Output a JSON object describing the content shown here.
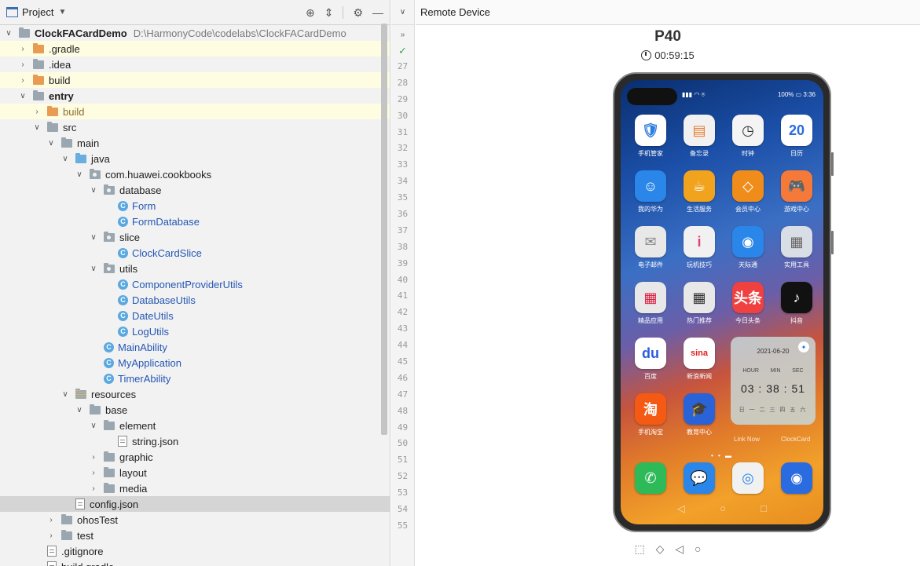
{
  "project_panel": {
    "title": "Project",
    "tree": [
      {
        "label": "ClockFACardDemo",
        "path": "D:\\HarmonyCode\\codelabs\\ClockFACardDemo",
        "depth": 0,
        "arrow": "open",
        "icon": "module",
        "style": "bold"
      },
      {
        "label": ".gradle",
        "depth": 1,
        "arrow": "closed",
        "icon": "orange",
        "hl": true
      },
      {
        "label": ".idea",
        "depth": 1,
        "arrow": "closed",
        "icon": "folder"
      },
      {
        "label": "build",
        "depth": 1,
        "arrow": "closed",
        "icon": "orange",
        "hl": true
      },
      {
        "label": "entry",
        "depth": 1,
        "arrow": "open",
        "icon": "module",
        "style": "bold"
      },
      {
        "label": "build",
        "depth": 2,
        "arrow": "closed",
        "icon": "orange",
        "hl": true,
        "style": "dimorange"
      },
      {
        "label": "src",
        "depth": 2,
        "arrow": "open",
        "icon": "folder"
      },
      {
        "label": "main",
        "depth": 3,
        "arrow": "open",
        "icon": "folder"
      },
      {
        "label": "java",
        "depth": 4,
        "arrow": "open",
        "icon": "blue"
      },
      {
        "label": "com.huawei.cookbooks",
        "depth": 5,
        "arrow": "open",
        "icon": "pkg"
      },
      {
        "label": "database",
        "depth": 6,
        "arrow": "open",
        "icon": "pkg"
      },
      {
        "label": "Form",
        "depth": 7,
        "arrow": "none",
        "icon": "class",
        "style": "blue"
      },
      {
        "label": "FormDatabase",
        "depth": 7,
        "arrow": "none",
        "icon": "class",
        "style": "blue"
      },
      {
        "label": "slice",
        "depth": 6,
        "arrow": "open",
        "icon": "pkg"
      },
      {
        "label": "ClockCardSlice",
        "depth": 7,
        "arrow": "none",
        "icon": "class",
        "style": "blue"
      },
      {
        "label": "utils",
        "depth": 6,
        "arrow": "open",
        "icon": "pkg"
      },
      {
        "label": "ComponentProviderUtils",
        "depth": 7,
        "arrow": "none",
        "icon": "class",
        "style": "blue"
      },
      {
        "label": "DatabaseUtils",
        "depth": 7,
        "arrow": "none",
        "icon": "class",
        "style": "blue"
      },
      {
        "label": "DateUtils",
        "depth": 7,
        "arrow": "none",
        "icon": "class",
        "style": "blue"
      },
      {
        "label": "LogUtils",
        "depth": 7,
        "arrow": "none",
        "icon": "class",
        "style": "blue"
      },
      {
        "label": "MainAbility",
        "depth": 6,
        "arrow": "none",
        "icon": "class",
        "style": "blue"
      },
      {
        "label": "MyApplication",
        "depth": 6,
        "arrow": "none",
        "icon": "class",
        "style": "blue"
      },
      {
        "label": "TimerAbility",
        "depth": 6,
        "arrow": "none",
        "icon": "class",
        "style": "blue"
      },
      {
        "label": "resources",
        "depth": 4,
        "arrow": "open",
        "icon": "res"
      },
      {
        "label": "base",
        "depth": 5,
        "arrow": "open",
        "icon": "folder"
      },
      {
        "label": "element",
        "depth": 6,
        "arrow": "open",
        "icon": "folder"
      },
      {
        "label": "string.json",
        "depth": 7,
        "arrow": "none",
        "icon": "file"
      },
      {
        "label": "graphic",
        "depth": 6,
        "arrow": "closed",
        "icon": "folder"
      },
      {
        "label": "layout",
        "depth": 6,
        "arrow": "closed",
        "icon": "folder"
      },
      {
        "label": "media",
        "depth": 6,
        "arrow": "closed",
        "icon": "folder"
      },
      {
        "label": "config.json",
        "depth": 4,
        "arrow": "none",
        "icon": "file",
        "sel": true
      },
      {
        "label": "ohosTest",
        "depth": 3,
        "arrow": "closed",
        "icon": "folder"
      },
      {
        "label": "test",
        "depth": 3,
        "arrow": "closed",
        "icon": "folder"
      },
      {
        "label": ".gitignore",
        "depth": 2,
        "arrow": "none",
        "icon": "file"
      },
      {
        "label": "build.gradle",
        "depth": 2,
        "arrow": "none",
        "icon": "file"
      }
    ]
  },
  "gutter": {
    "lines": [
      "27",
      "28",
      "29",
      "30",
      "31",
      "32",
      "33",
      "34",
      "35",
      "36",
      "37",
      "38",
      "39",
      "40",
      "41",
      "42",
      "43",
      "44",
      "45",
      "46",
      "47",
      "48",
      "49",
      "50",
      "51",
      "52",
      "53",
      "54",
      "55"
    ]
  },
  "remote_device": {
    "header": "Remote Device",
    "device": "P40",
    "timer": "00:59:15",
    "status_right": "100% ▭ 3:36",
    "apps": [
      {
        "name": "手机管家",
        "color": "#ffffff",
        "glyph": "🛡",
        "fg": "#2a7de1"
      },
      {
        "name": "备忘录",
        "color": "#f1f1f1",
        "glyph": "▤",
        "fg": "#e97a2a"
      },
      {
        "name": "时钟",
        "color": "#f4f4f4",
        "glyph": "◷",
        "fg": "#333"
      },
      {
        "name": "日历",
        "color": "#ffffff",
        "glyph": "20",
        "fg": "#2a6be0"
      },
      {
        "name": "我的华为",
        "color": "#2a86e8",
        "glyph": "☺",
        "fg": "#fff"
      },
      {
        "name": "生活服务",
        "color": "#f2a31e",
        "glyph": "☕",
        "fg": "#fff"
      },
      {
        "name": "会员中心",
        "color": "#f08d1a",
        "glyph": "◇",
        "fg": "#fff"
      },
      {
        "name": "游戏中心",
        "color": "#f57a3a",
        "glyph": "🎮",
        "fg": "#fff"
      },
      {
        "name": "电子邮件",
        "color": "#e8e8e8",
        "glyph": "✉",
        "fg": "#888"
      },
      {
        "name": "玩机技巧",
        "color": "#f1f1f1",
        "glyph": "i",
        "fg": "#e0407a"
      },
      {
        "name": "天际通",
        "color": "#2a86e8",
        "glyph": "◉",
        "fg": "#fff"
      },
      {
        "name": "实用工具",
        "color": "#d9dde5",
        "glyph": "▦",
        "fg": "#666"
      },
      {
        "name": "精品应用",
        "color": "#e8e8e8",
        "glyph": "▦",
        "fg": "#d24"
      },
      {
        "name": "热门推荐",
        "color": "#e8e8e8",
        "glyph": "▦",
        "fg": "#333"
      },
      {
        "name": "今日头条",
        "color": "#f04141",
        "glyph": "头条",
        "fg": "#fff"
      },
      {
        "name": "抖音",
        "color": "#111111",
        "glyph": "♪",
        "fg": "#fff"
      },
      {
        "name": "百度",
        "color": "#ffffff",
        "glyph": "du",
        "fg": "#2a5be0"
      },
      {
        "name": "新浪新闻",
        "color": "#ffffff",
        "glyph": "sina",
        "fg": "#e02020"
      },
      {
        "name": "手机淘宝",
        "color": "#f55a14",
        "glyph": "淘",
        "fg": "#fff"
      },
      {
        "name": "教育中心",
        "color": "#2a62d8",
        "glyph": "🎓",
        "fg": "#fff"
      }
    ],
    "card": {
      "date": "2021-06-20",
      "hour": "HOUR",
      "min": "MIN",
      "sec": "SEC",
      "time": "03 : 38 : 51",
      "week": "日 一 二 三 四 五 六",
      "link_now": "Link Now",
      "clock_card": "ClockCard"
    },
    "dock": [
      {
        "color": "#2fba5a",
        "glyph": "✆",
        "fg": "#fff"
      },
      {
        "color": "#2a86e8",
        "glyph": "💬",
        "fg": "#fff"
      },
      {
        "color": "#f1f1f1",
        "glyph": "◎",
        "fg": "#2a86e8"
      },
      {
        "color": "#2a6be0",
        "glyph": "◉",
        "fg": "#fff"
      }
    ]
  }
}
